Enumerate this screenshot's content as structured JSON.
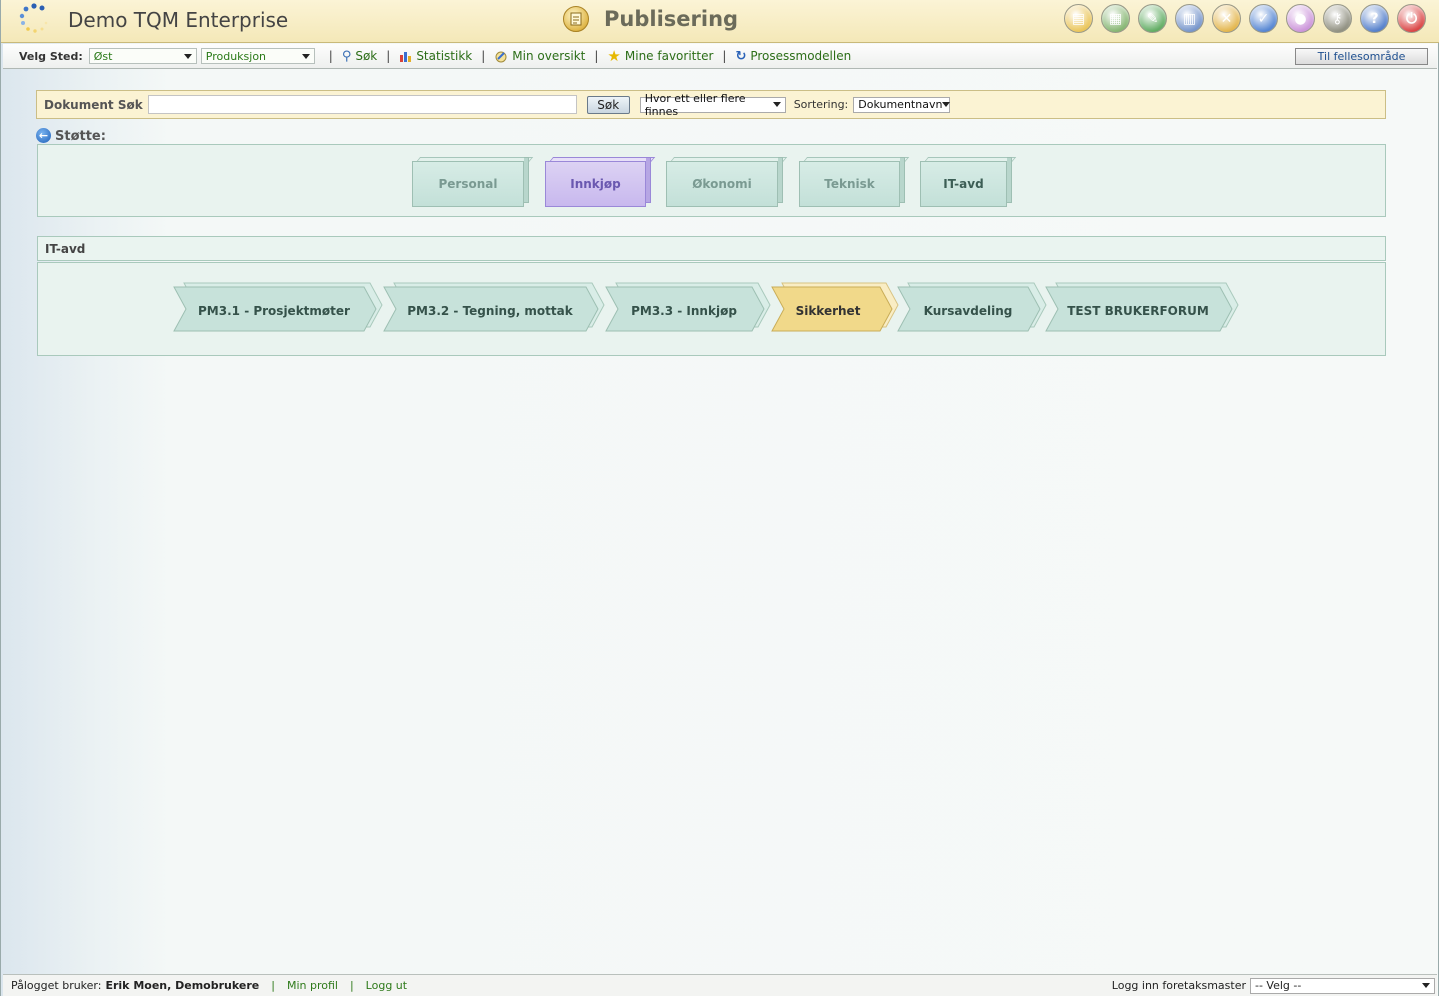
{
  "header": {
    "app_title": "Demo TQM Enterprise",
    "module_title": "Publisering",
    "tool_icons": [
      {
        "name": "document-icon",
        "glyph": "▤",
        "color": "#e9c250"
      },
      {
        "name": "modules-icon",
        "glyph": "▦",
        "color": "#7fb26a"
      },
      {
        "name": "wrench-icon",
        "glyph": "✎",
        "color": "#58a85a"
      },
      {
        "name": "calendar-icon",
        "glyph": "▥",
        "color": "#6e8fc8"
      },
      {
        "name": "tools-icon",
        "glyph": "✕",
        "color": "#e2b243"
      },
      {
        "name": "checkmark-icon",
        "glyph": "✓",
        "color": "#4c7fd0"
      },
      {
        "name": "users-icon",
        "glyph": "●",
        "color": "#c98fd8"
      },
      {
        "name": "key-icon",
        "glyph": "⚷",
        "color": "#8a8a7a"
      },
      {
        "name": "help-icon",
        "glyph": "?",
        "color": "#4a78c8"
      },
      {
        "name": "power-icon",
        "glyph": "⏻",
        "color": "#d83a3a"
      }
    ]
  },
  "nav": {
    "location_label": "Velg Sted:",
    "location_value": "Øst",
    "department_value": "Produksjon",
    "links": [
      {
        "label": "Søk",
        "icon": "magnifier-icon",
        "glyph": "🔍"
      },
      {
        "label": "Statistikk",
        "icon": "bar-chart-icon",
        "glyph": "▮"
      },
      {
        "label": "Min oversikt",
        "icon": "overview-icon",
        "glyph": "✎"
      },
      {
        "label": "Mine favoritter",
        "icon": "star-icon",
        "glyph": "★"
      },
      {
        "label": "Prosessmodellen",
        "icon": "refresh-icon",
        "glyph": "↻"
      }
    ],
    "shared_area_button": "Til fellesområde"
  },
  "search": {
    "label": "Dokument Søk",
    "query": "",
    "button": "Søk",
    "mode": "Hvor ett eller flere finnes",
    "sort_label": "Sortering:",
    "sort_value": "Dokumentnavn"
  },
  "breadcrumb": {
    "back_label": "Støtte:"
  },
  "departments": [
    {
      "label": "Personal",
      "state": "normal"
    },
    {
      "label": "Innkjøp",
      "state": "active"
    },
    {
      "label": "Økonomi",
      "state": "normal"
    },
    {
      "label": "Teknisk",
      "state": "normal"
    },
    {
      "label": "IT-avd",
      "state": "current"
    }
  ],
  "process_section": {
    "title": "IT-avd",
    "processes": [
      {
        "label": "PM3.1 - Prosjektmøter",
        "highlight": false
      },
      {
        "label": "PM3.2 - Tegning, mottak",
        "highlight": false
      },
      {
        "label": "PM3.3 - Innkjøp",
        "highlight": false
      },
      {
        "label": "Sikkerhet",
        "highlight": true
      },
      {
        "label": "Kursavdeling",
        "highlight": false
      },
      {
        "label": "TEST BRUKERFORUM",
        "highlight": false
      }
    ]
  },
  "footer": {
    "user_label": "Pålogget bruker:",
    "user_name": "Erik Moen, Demobrukere",
    "profile_link": "Min profil",
    "logout_link": "Logg ut",
    "master_label": "Logg inn foretaksmaster",
    "master_select": "-- Velg --"
  },
  "colors": {
    "header_bg": "#f4e8b8",
    "link_green": "#2c6e18",
    "panel_bg": "#e9f3ef",
    "chevron_fill": "#c7e2da",
    "chevron_highlight": "#f1d98a",
    "active_block": "#c8b8ee"
  }
}
